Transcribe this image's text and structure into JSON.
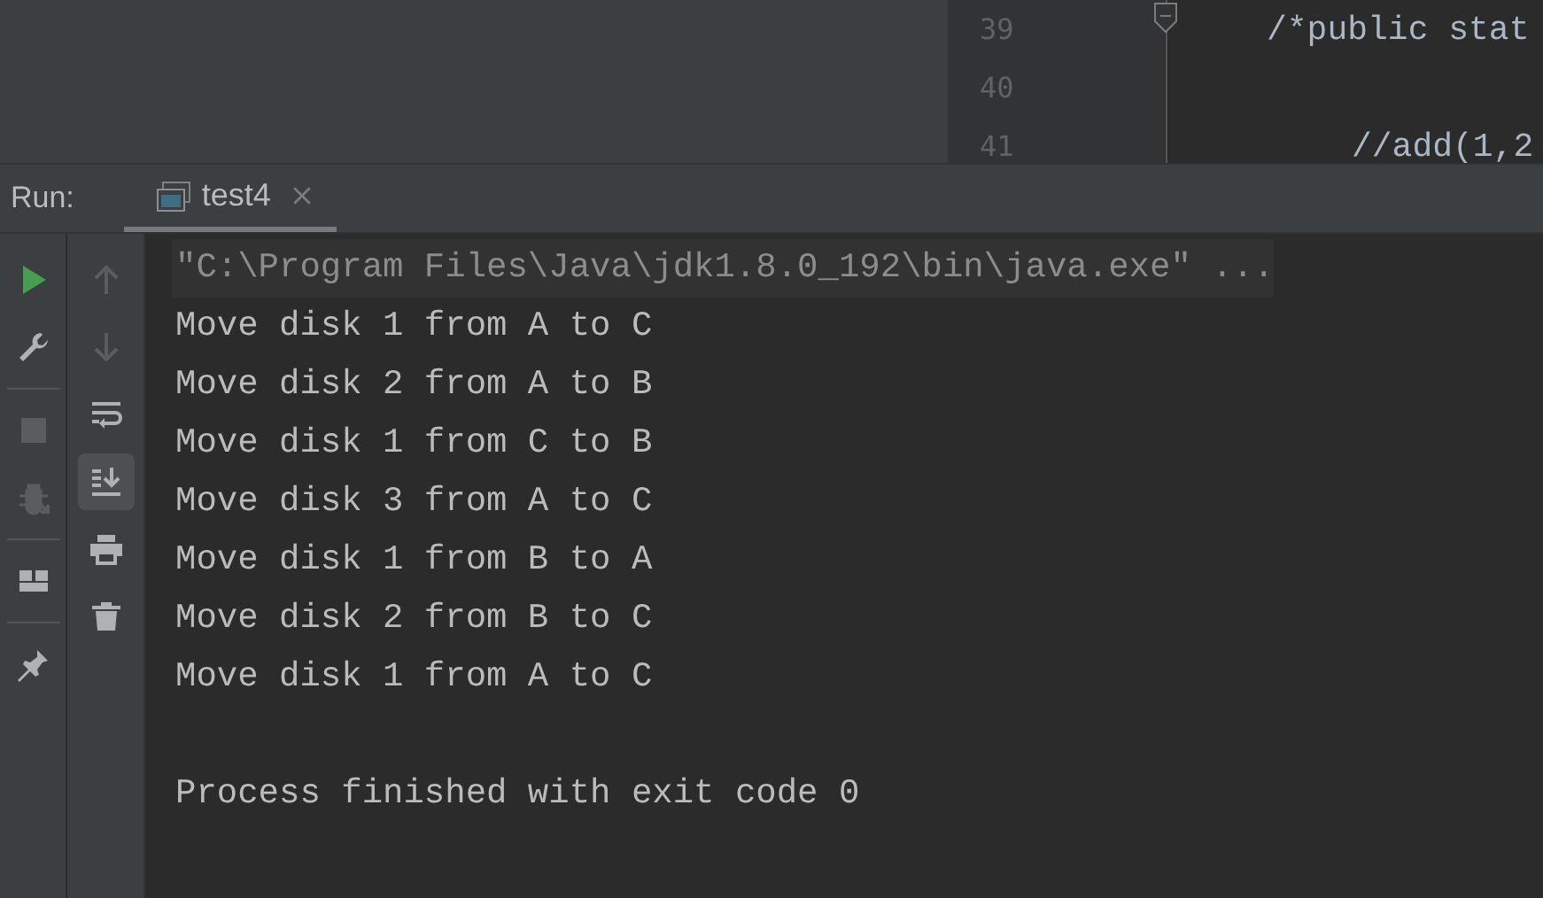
{
  "editor": {
    "lines": [
      {
        "number": "39",
        "code": "/*public stat",
        "fold": true,
        "children": [
          {
            "number": "40",
            "fold": false
          },
          {
            "number": "41",
            "code": "//add(1,2",
            "fold": false
          }
        ]
      }
    ]
  },
  "run_panel": {
    "label": "Run:",
    "tabs": [
      {
        "label": "test4",
        "selected": true,
        "closable": true
      }
    ]
  },
  "left_toolbar": [
    {
      "kind": "run",
      "disabled": false
    },
    {
      "kind": "wrench",
      "disabled": false
    },
    {
      "kind": "separator"
    },
    {
      "kind": "stop",
      "disabled": true
    },
    {
      "kind": "bug",
      "disabled": true
    },
    {
      "kind": "separator"
    },
    {
      "kind": "layout",
      "disabled": false
    },
    {
      "kind": "separator"
    },
    {
      "kind": "pin",
      "disabled": false
    }
  ],
  "console_toolbar": [
    {
      "kind": "up",
      "disabled": true,
      "on": false
    },
    {
      "kind": "down",
      "disabled": true,
      "on": false
    },
    {
      "kind": "wrap",
      "disabled": false,
      "on": false
    },
    {
      "kind": "scroll-end",
      "disabled": false,
      "on": true
    },
    {
      "kind": "print",
      "disabled": false,
      "on": false
    },
    {
      "kind": "trash",
      "disabled": false,
      "on": false
    }
  ],
  "console": [
    {
      "kind": "command",
      "text": "\"C:\\Program Files\\Java\\jdk1.8.0_192\\bin\\java.exe\" ..."
    },
    {
      "kind": "output",
      "text": "Move disk 1 from A to C"
    },
    {
      "kind": "output",
      "text": "Move disk 2 from A to B"
    },
    {
      "kind": "output",
      "text": "Move disk 1 from C to B"
    },
    {
      "kind": "output",
      "text": "Move disk 3 from A to C"
    },
    {
      "kind": "output",
      "text": "Move disk 1 from B to A"
    },
    {
      "kind": "output",
      "text": "Move disk 2 from B to C"
    },
    {
      "kind": "output",
      "text": "Move disk 1 from A to C"
    },
    {
      "kind": "status",
      "text": "Process finished with exit code 0"
    }
  ]
}
